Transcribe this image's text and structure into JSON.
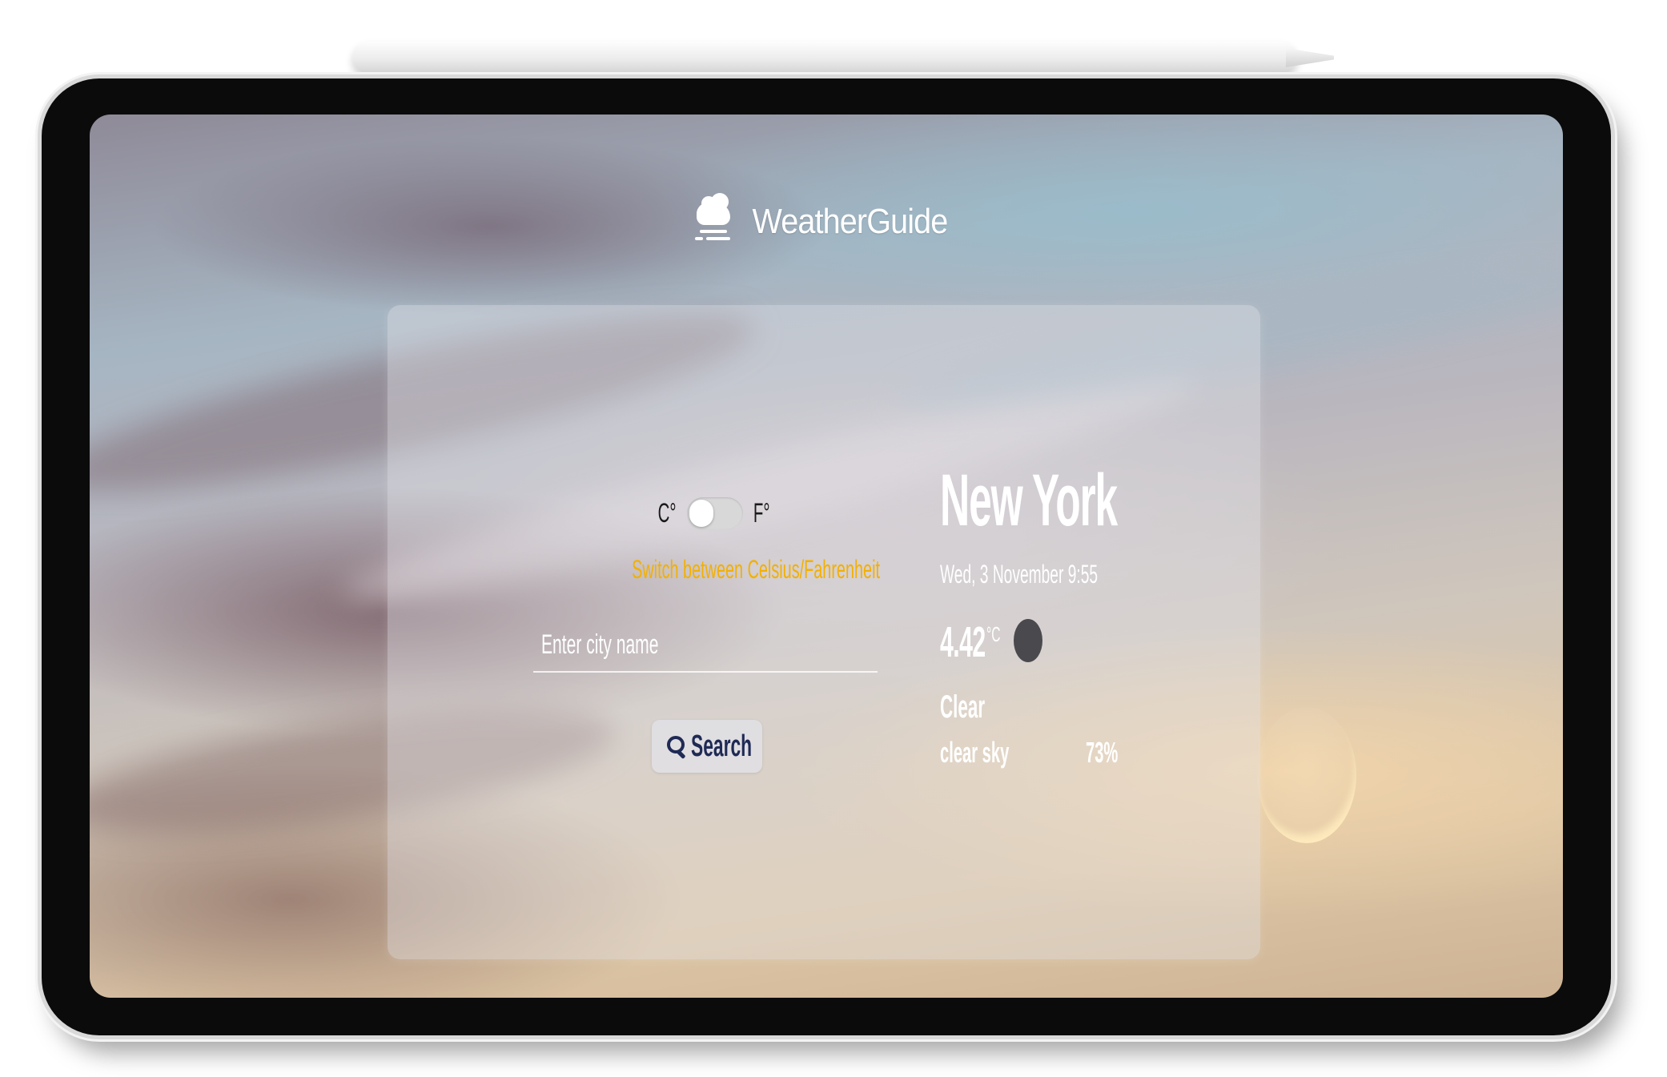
{
  "brand": {
    "title": "WeatherGuide",
    "icon": "cloud-icon"
  },
  "units": {
    "celsius_label": "C°",
    "fahrenheit_label": "F°",
    "selected": "C°",
    "hint": "Switch between Celsius/Fahrenheit"
  },
  "search": {
    "placeholder": "Enter city name",
    "value": "",
    "button_label": "Search",
    "button_icon": "search-icon"
  },
  "weather": {
    "city": "New York",
    "datetime": "Wed, 3 November 9:55",
    "temperature": "4.42",
    "temperature_unit": "°C",
    "condition": "Clear",
    "description": "clear sky",
    "humidity": "73%",
    "icon": "weather-condition-icon"
  },
  "colors": {
    "hint": "#f3b000",
    "search_text": "#1f2a55",
    "text": "#ffffff"
  }
}
